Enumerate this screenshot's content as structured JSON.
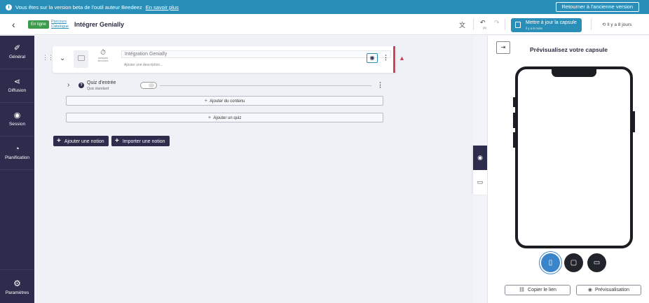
{
  "banner": {
    "info_icon": "i",
    "message": "Vous êtes sur la version beta de l'outil auteur Beedeez",
    "link": "En savoir plus",
    "old_version_button": "Retourner à l'ancienne version"
  },
  "topbar": {
    "back_icon": "‹",
    "status_badge": "En ligne",
    "breadcrumb_line1": "Parcours",
    "breadcrumb_line2": "Catalogue",
    "capsule_title": "Intégrer Genially",
    "translate_icon": "文",
    "undo_icon": "↶",
    "undo_count": "(5)",
    "redo_icon": "↷",
    "update_button": "Mettre à jour la capsule",
    "update_subtitle": "il y a 6 mois",
    "time_icon": "⟲",
    "time_ago": "Il y a 8 jours"
  },
  "sidebar": {
    "items": [
      {
        "label": "Général",
        "icon": "✐"
      },
      {
        "label": "Diffusion",
        "icon": "⋖"
      },
      {
        "label": "Session",
        "icon": "◉"
      },
      {
        "label": "Planification",
        "icon": "◔"
      }
    ],
    "settings": {
      "label": "Paramètres",
      "icon": "⚙"
    }
  },
  "notion_card": {
    "drag_icon": "⋮⋮",
    "chevron": "⌄",
    "timer_icon": "⏱",
    "timer_label": "quelques secondes",
    "title_value": "Intégration Genially",
    "description_placeholder": "Ajouter une description...",
    "eye_icon": "◉",
    "kebab": "⋮",
    "warning_icon": "▲"
  },
  "quiz": {
    "chevron": "›",
    "q_icon": "?",
    "title": "Quiz d'entrée",
    "subtitle": "Quiz standard",
    "kebab": "⋮"
  },
  "actions": {
    "plus": "+",
    "add_content": "Ajouter du contenu",
    "add_quiz": "Ajouter un quiz",
    "add_notion": "Ajouter une notion",
    "import_notion": "Importer une notion"
  },
  "side_tabs": {
    "preview_icon": "◉",
    "chat_icon": "▭"
  },
  "preview": {
    "collapse_icon": "⇥",
    "title": "Prévisualisez votre capsule",
    "devices": [
      {
        "name": "phone",
        "icon": "▯",
        "selected": true
      },
      {
        "name": "tablet",
        "icon": "▢",
        "selected": false
      },
      {
        "name": "desktop",
        "icon": "▭",
        "selected": false
      }
    ],
    "copy_icon": "⛓",
    "copy_link": "Copier le lien",
    "preview_icon": "◉",
    "preview_button": "Prévisualisation"
  }
}
